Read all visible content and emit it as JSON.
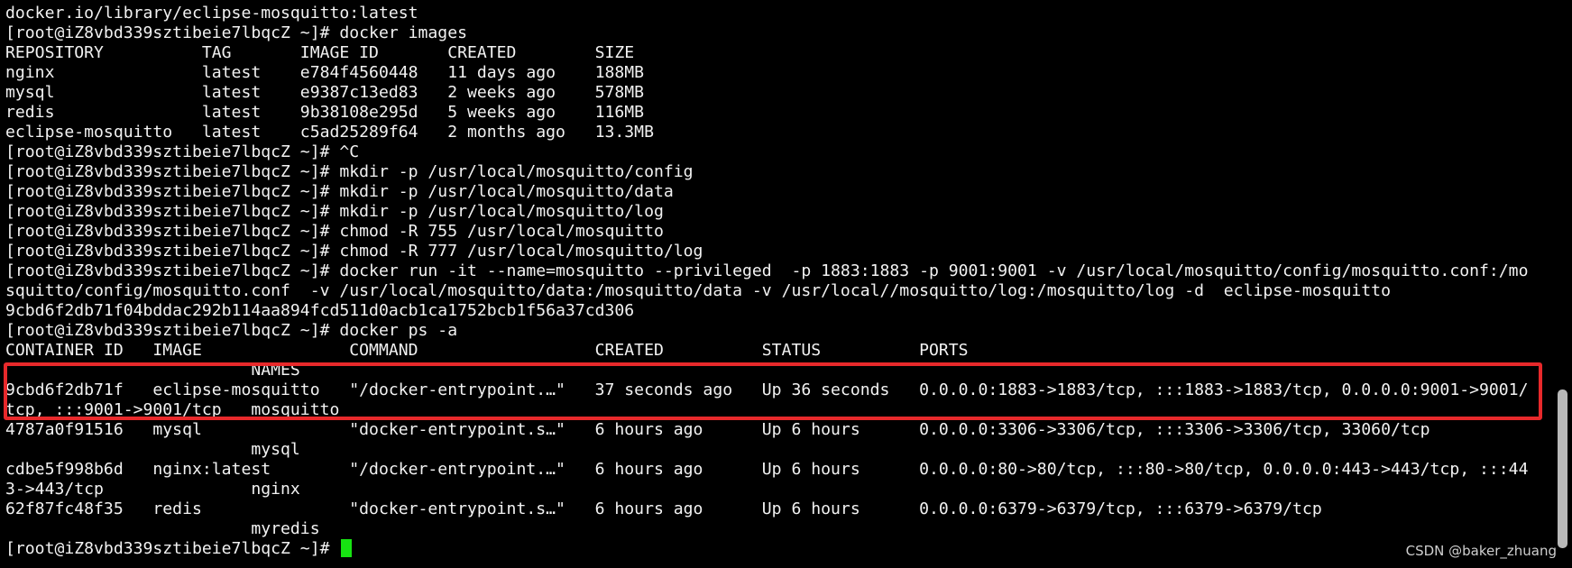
{
  "terminal": {
    "lines": [
      "docker.io/library/eclipse-mosquitto:latest",
      "[root@iZ8vbd339sztibeie7lbqcZ ~]# docker images",
      "REPOSITORY          TAG       IMAGE ID       CREATED        SIZE",
      "nginx               latest    e784f4560448   11 days ago    188MB",
      "mysql               latest    e9387c13ed83   2 weeks ago    578MB",
      "redis               latest    9b38108e295d   5 weeks ago    116MB",
      "eclipse-mosquitto   latest    c5ad25289f64   2 months ago   13.3MB",
      "[root@iZ8vbd339sztibeie7lbqcZ ~]# ^C",
      "[root@iZ8vbd339sztibeie7lbqcZ ~]# mkdir -p /usr/local/mosquitto/config",
      "[root@iZ8vbd339sztibeie7lbqcZ ~]# mkdir -p /usr/local/mosquitto/data",
      "[root@iZ8vbd339sztibeie7lbqcZ ~]# mkdir -p /usr/local/mosquitto/log",
      "[root@iZ8vbd339sztibeie7lbqcZ ~]# chmod -R 755 /usr/local/mosquitto",
      "[root@iZ8vbd339sztibeie7lbqcZ ~]# chmod -R 777 /usr/local/mosquitto/log",
      "[root@iZ8vbd339sztibeie7lbqcZ ~]# docker run -it --name=mosquitto --privileged  -p 1883:1883 -p 9001:9001 -v /usr/local/mosquitto/config/mosquitto.conf:/mo",
      "squitto/config/mosquitto.conf  -v /usr/local/mosquitto/data:/mosquitto/data -v /usr/local//mosquitto/log:/mosquitto/log -d  eclipse-mosquitto",
      "9cbd6f2db71f04bddac292b114aa894fcd511d0acb1ca1752bcb1f56a37cd306",
      "[root@iZ8vbd339sztibeie7lbqcZ ~]# docker ps -a",
      "CONTAINER ID   IMAGE               COMMAND                  CREATED          STATUS          PORTS",
      "                         NAMES",
      "9cbd6f2db71f   eclipse-mosquitto   \"/docker-entrypoint.…\"   37 seconds ago   Up 36 seconds   0.0.0.0:1883->1883/tcp, :::1883->1883/tcp, 0.0.0.0:9001->9001/",
      "tcp, :::9001->9001/tcp   mosquitto",
      "4787a0f91516   mysql               \"docker-entrypoint.s…\"   6 hours ago      Up 6 hours      0.0.0.0:3306->3306/tcp, :::3306->3306/tcp, 33060/tcp",
      "                         mysql",
      "cdbe5f998b6d   nginx:latest        \"/docker-entrypoint.…\"   6 hours ago      Up 6 hours      0.0.0.0:80->80/tcp, :::80->80/tcp, 0.0.0.0:443->443/tcp, :::44",
      "3->443/tcp               nginx",
      "62f87fc48f35   redis               \"docker-entrypoint.s…\"   6 hours ago      Up 6 hours      0.0.0.0:6379->6379/tcp, :::6379->6379/tcp",
      "                         myredis"
    ],
    "prompt": "[root@iZ8vbd339sztibeie7lbqcZ ~]# "
  },
  "watermark": "CSDN @baker_zhuang",
  "colors": {
    "background": "#000000",
    "foreground": "#f2f2f2",
    "cursor": "#17e312",
    "highlight_border": "#e8292b"
  }
}
